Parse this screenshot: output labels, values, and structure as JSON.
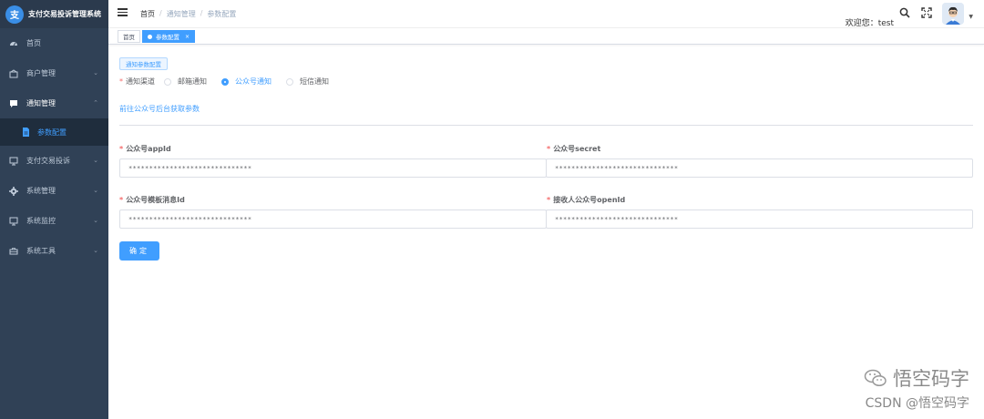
{
  "app": {
    "title": "支付交易投诉管理系统",
    "logo_char": "支"
  },
  "sidebar": {
    "items": [
      {
        "label": "首页",
        "icon": "dashboard-icon"
      },
      {
        "label": "商户管理",
        "icon": "merchant-icon",
        "expandable": true
      },
      {
        "label": "通知管理",
        "icon": "message-icon",
        "expandable": true,
        "open": true
      },
      {
        "label": "支付交易投诉",
        "icon": "complaint-icon",
        "expandable": true
      },
      {
        "label": "系统管理",
        "icon": "gear-icon",
        "expandable": true
      },
      {
        "label": "系统监控",
        "icon": "monitor-icon",
        "expandable": true
      },
      {
        "label": "系统工具",
        "icon": "toolbox-icon",
        "expandable": true
      }
    ],
    "subitem": {
      "label": "参数配置",
      "icon": "document-icon",
      "active": true
    }
  },
  "header": {
    "breadcrumb": {
      "home": "首页",
      "sep1": "/",
      "level1": "通知管理",
      "sep2": "/",
      "level2": "参数配置"
    },
    "welcome": "欢迎您：test"
  },
  "tags": [
    {
      "label": "首页",
      "active": false
    },
    {
      "label": "参数配置",
      "active": true,
      "close": "×"
    }
  ],
  "form": {
    "section_button": "通知参数配置",
    "channel_label": "通知渠道",
    "required_mark": "*",
    "channels": [
      {
        "label": "邮箱通知",
        "checked": false
      },
      {
        "label": "公众号通知",
        "checked": true
      },
      {
        "label": "短信通知",
        "checked": false
      }
    ],
    "link_text": "前往公众号后台获取参数",
    "fields": [
      {
        "label": "公众号appId",
        "value": "******************************"
      },
      {
        "label": "公众号secret",
        "value": "******************************"
      },
      {
        "label": "公众号模板消息Id",
        "value": "******************************"
      },
      {
        "label": "接收人公众号openId",
        "value": "******************************"
      }
    ],
    "submit": "确定"
  },
  "watermark": {
    "line1": "悟空码字",
    "line2": "CSDN @悟空码字"
  },
  "colors": {
    "primary": "#409eff",
    "sidebar": "#304156",
    "required": "#f56c6c"
  }
}
